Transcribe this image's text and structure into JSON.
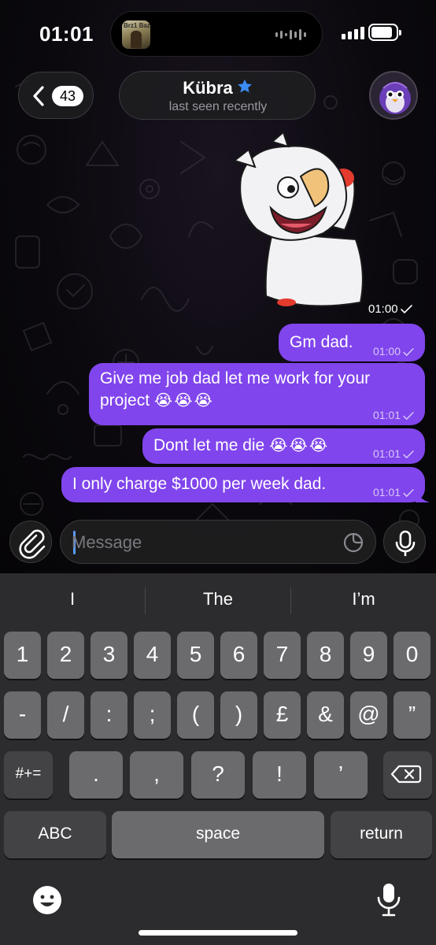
{
  "status_bar": {
    "time": "01:01",
    "now_playing_art_text": "Brz1 Bazz"
  },
  "header": {
    "back_count": "43",
    "contact_name": "Kübra",
    "contact_status": "last seen recently",
    "verified_star_color": "#3b8cf5"
  },
  "messages": [
    {
      "type": "sticker",
      "time": "01:00",
      "status": "sent"
    },
    {
      "type": "text",
      "text": "Gm dad.",
      "time": "01:00",
      "status": "sent"
    },
    {
      "type": "text",
      "line1": "Give me job dad let me work for your",
      "line2": "project",
      "emoji": "😭😭😭",
      "time": "01:01",
      "status": "sent"
    },
    {
      "type": "text",
      "text": "Dont let me die",
      "emoji": "😭😭😭",
      "time": "01:01",
      "status": "sent"
    },
    {
      "type": "text",
      "text": "I only charge $1000 per week dad.",
      "time": "01:01",
      "status": "sent"
    }
  ],
  "composer": {
    "placeholder": "Message",
    "value": ""
  },
  "keyboard": {
    "suggestions": [
      "I",
      "The",
      "I’m"
    ],
    "row1": [
      "1",
      "2",
      "3",
      "4",
      "5",
      "6",
      "7",
      "8",
      "9",
      "0"
    ],
    "row2": [
      "-",
      "/",
      ":",
      ";",
      "(",
      ")",
      "£",
      "&",
      "@",
      "”"
    ],
    "row3_mode": "#+=",
    "row3": [
      ".",
      ",",
      "?",
      "!",
      "’"
    ],
    "abc": "ABC",
    "space": "space",
    "return": "return"
  },
  "colors": {
    "bubble": "#8045ec",
    "keyboard_bg": "#2c2c2e",
    "key": "#6b6b6e",
    "key_dark": "#434345",
    "caret": "#5a9bff"
  }
}
